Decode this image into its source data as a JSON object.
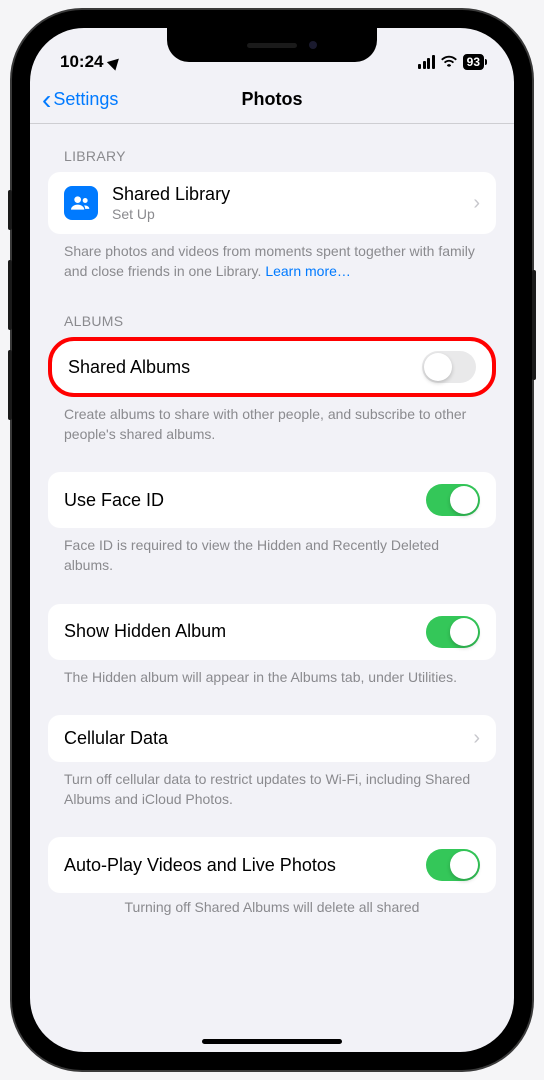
{
  "status": {
    "time": "10:24",
    "battery": "93"
  },
  "nav": {
    "back": "Settings",
    "title": "Photos"
  },
  "library": {
    "header": "LIBRARY",
    "shared_library": "Shared Library",
    "setup": "Set Up",
    "footer": "Share photos and videos from moments spent together with family and close friends in one Library.",
    "learn_more": "Learn more…"
  },
  "albums": {
    "header": "ALBUMS",
    "shared_albums": "Shared Albums",
    "shared_on": false,
    "footer": "Create albums to share with other people, and subscribe to other people's shared albums."
  },
  "faceid": {
    "title": "Use Face ID",
    "on": true,
    "footer": "Face ID is required to view the Hidden and Recently Deleted albums."
  },
  "hidden": {
    "title": "Show Hidden Album",
    "on": true,
    "footer": "The Hidden album will appear in the Albums tab, under Utilities."
  },
  "cellular": {
    "title": "Cellular Data",
    "footer": "Turn off cellular data to restrict updates to Wi-Fi, including Shared Albums and iCloud Photos."
  },
  "autoplay": {
    "title": "Auto-Play Videos and Live Photos",
    "on": true,
    "footer": "Turning off Shared Albums will delete all shared"
  }
}
